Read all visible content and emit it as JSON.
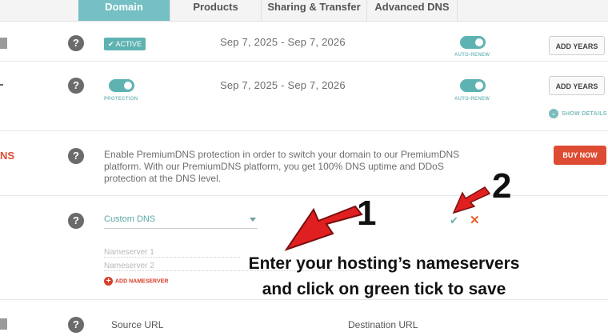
{
  "tabs": [
    "Domain",
    "Products",
    "Sharing & Transfer",
    "Advanced DNS"
  ],
  "rows": {
    "status": {
      "badge": "✔ ACTIVE",
      "dates": "Sep 7, 2025 - Sep 7, 2026",
      "auto_renew_label": "AUTO-RENEW",
      "button": "ADD YEARS"
    },
    "protection": {
      "label": "PROTECTION",
      "dates": "Sep 7, 2025 - Sep 7, 2026",
      "auto_renew_label": "AUTO-RENEW",
      "button": "ADD YEARS",
      "show_details": "SHOW DETAILS"
    },
    "premium_dns": {
      "left_label": "NS",
      "text": "Enable PremiumDNS protection in order to switch your domain to our PremiumDNS platform. With our PremiumDNS platform, you get 100% DNS uptime and DDoS protection at the DNS level.",
      "button": "BUY NOW"
    },
    "nameservers": {
      "select_value": "Custom DNS",
      "ns1_placeholder": "Nameserver 1",
      "ns2_placeholder": "Nameserver 2",
      "add_label": "ADD NAMESERVER",
      "save_icon": "check-icon",
      "cancel_icon": "x-icon"
    },
    "redirect": {
      "source_header": "Source URL",
      "destination_header": "Destination URL"
    }
  },
  "annotations": {
    "number1": "1",
    "number2": "2",
    "line1": "Enter your hosting’s nameservers",
    "line2": "and click on green tick to save"
  },
  "colors": {
    "teal": "#5fb2b2",
    "red": "#dd4c32",
    "arrow": "#e02020"
  }
}
